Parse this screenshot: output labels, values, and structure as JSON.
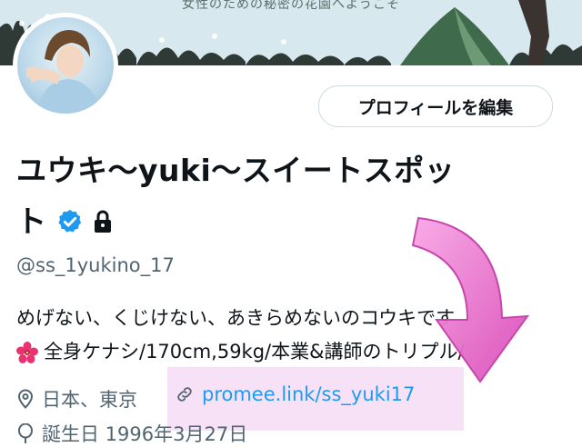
{
  "banner": {
    "caption": "女性のための秘密の花園へようこそ"
  },
  "profile": {
    "edit_button_label": "プロフィールを編集",
    "name_line1": "ユウキ〜yuki〜スイートスポッ",
    "name_line2": "ト",
    "handle": "@ss_1yukino_17",
    "bio_line1": "めげない、くじけない、あきらめないのコウキです",
    "bio_line2": "全身ケナシ/170cm,59kg/本業&講師のトリプル/",
    "location": "日本、東京",
    "link": "promee.link/ss_yuki17",
    "birthday": "誕生日 1996年3月27日"
  },
  "icons": {
    "verified": "verified-badge-icon",
    "lock": "lock-icon",
    "flower": "hibiscus-icon",
    "location": "location-pin-icon",
    "link": "link-icon",
    "birthday": "balloon-icon"
  },
  "colors": {
    "accent": "#1d9bf0",
    "secondary_text": "#536471",
    "highlight": "#f0c8f0",
    "arrow": "#e85fc8"
  }
}
